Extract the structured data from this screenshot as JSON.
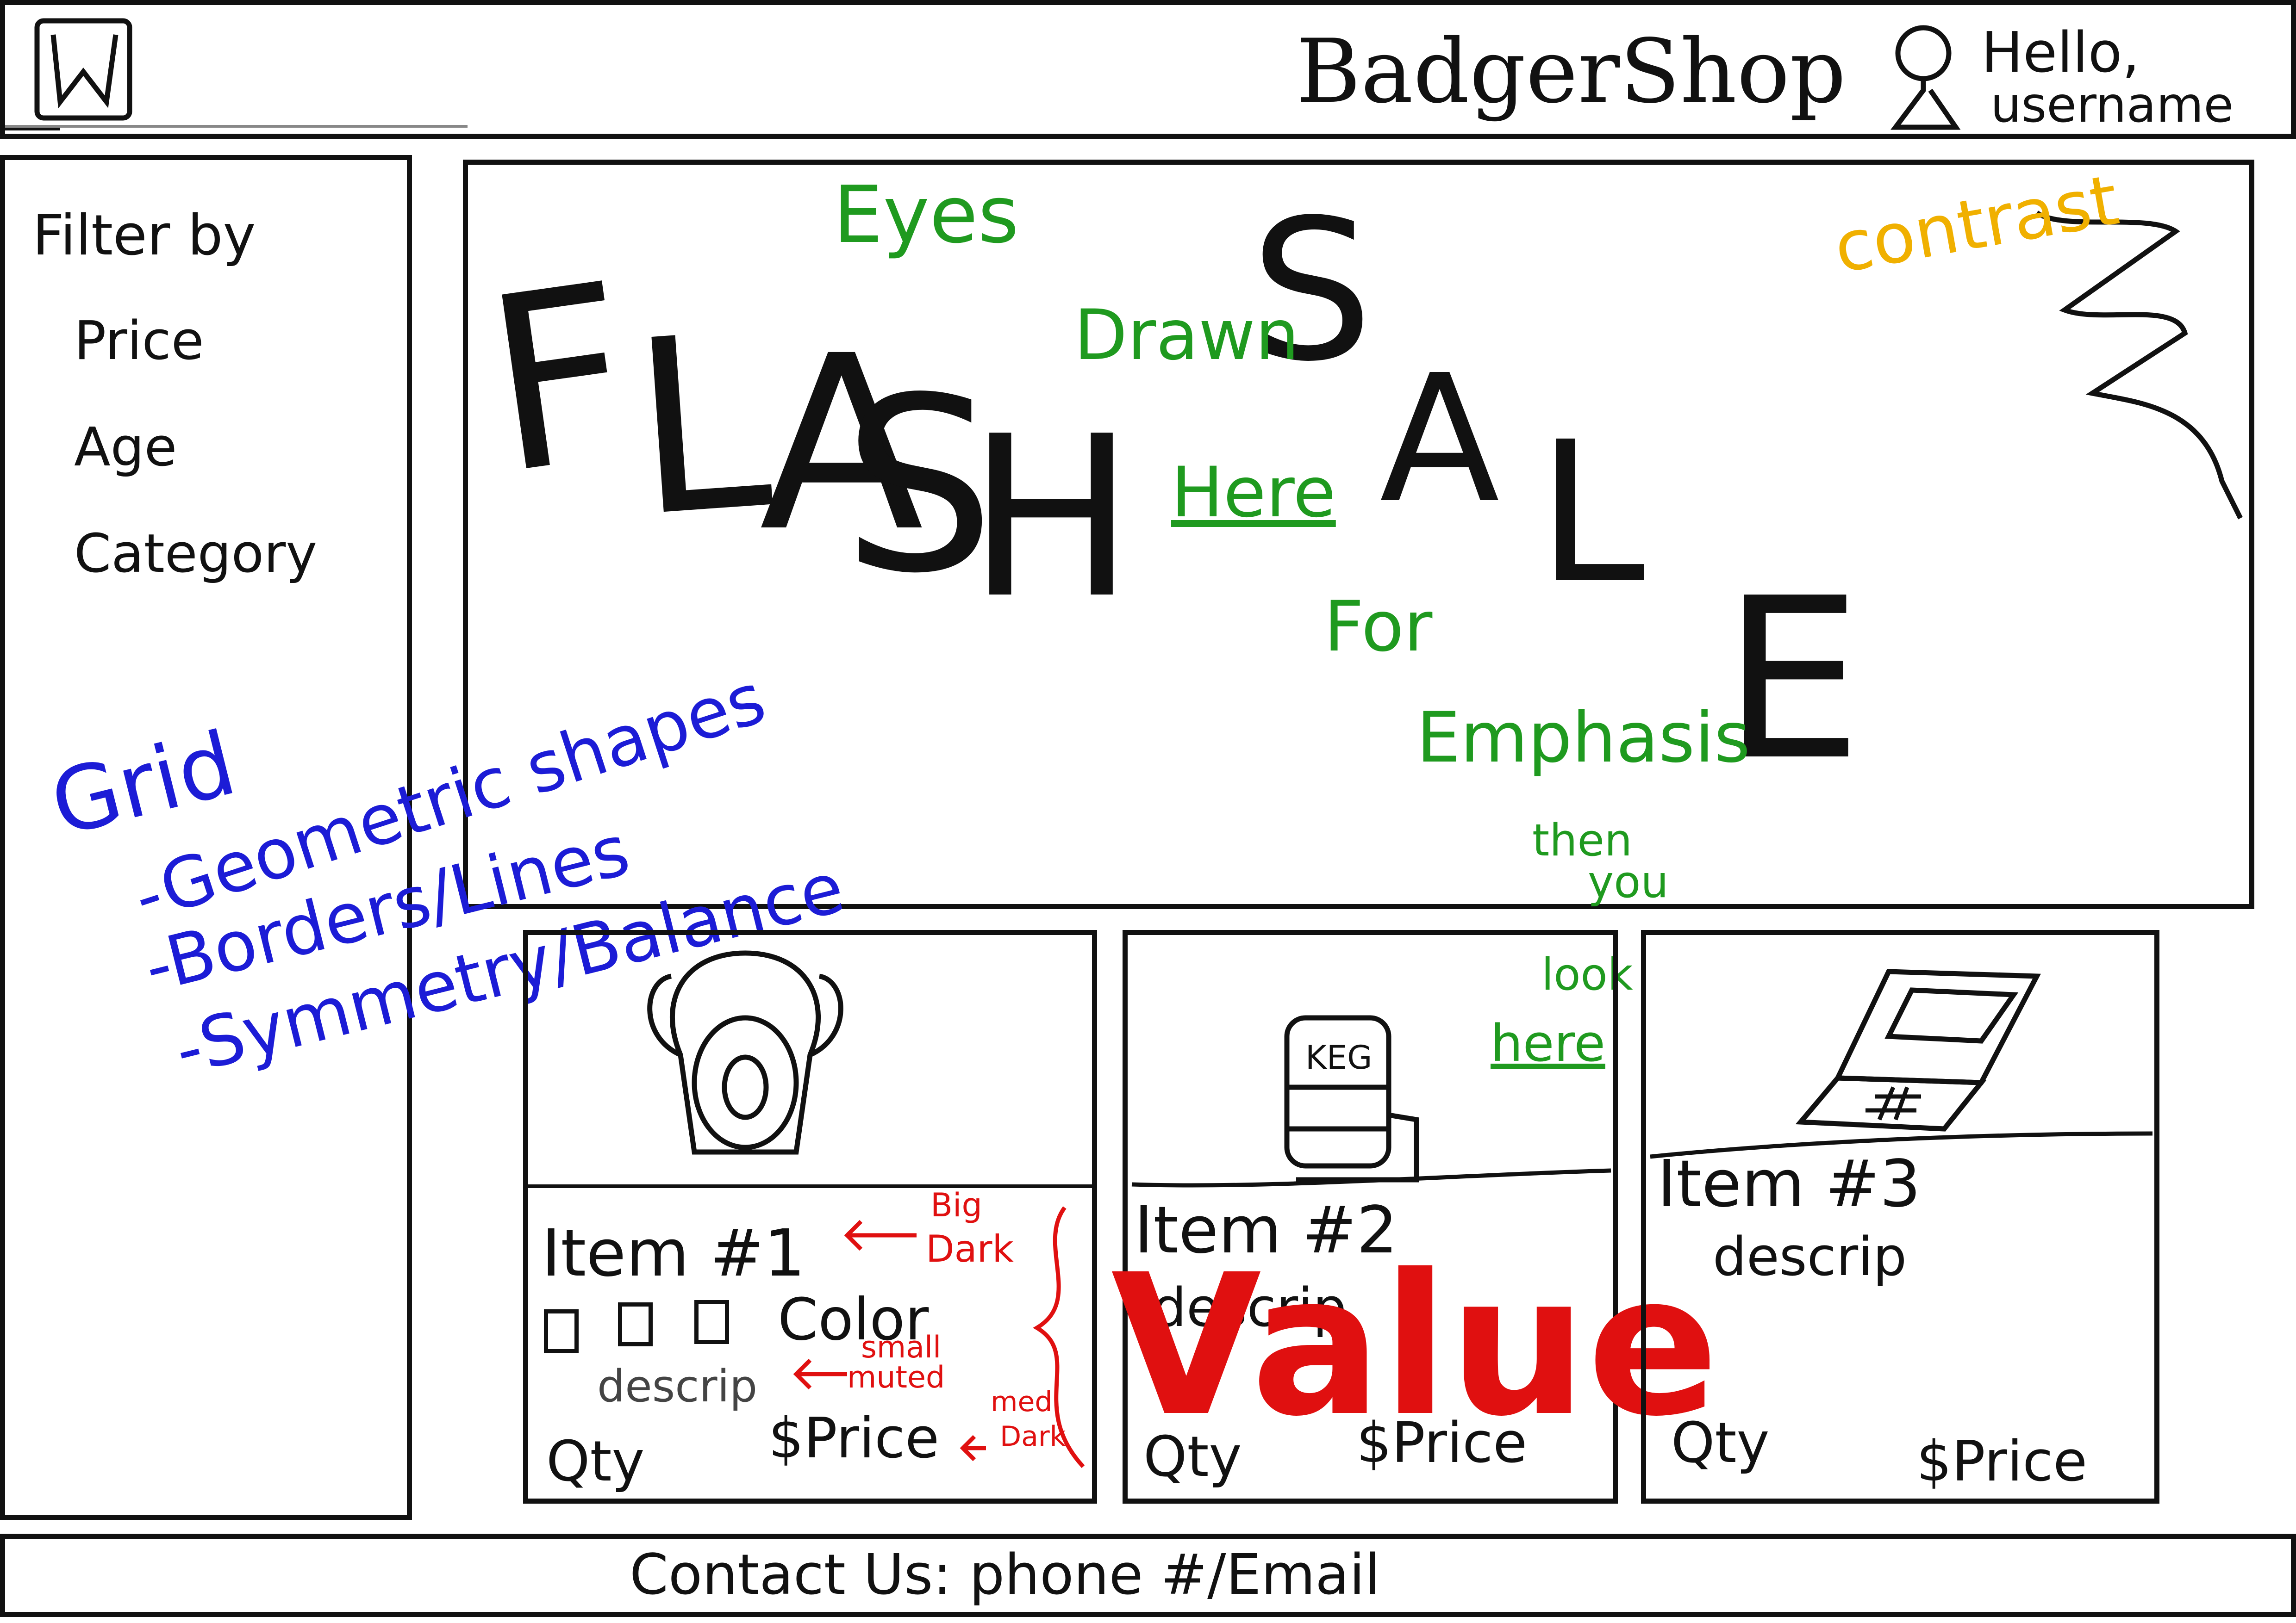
{
  "header": {
    "brand": "BadgerShop",
    "greeting": "Hello,",
    "username": "username",
    "logo_icon": "university-w-logo",
    "user_icon": "user-avatar-icon"
  },
  "sidebar": {
    "title": "Filter by",
    "options": [
      "Price",
      "Age",
      "Category"
    ]
  },
  "banner": {
    "headline_letters": [
      "F",
      "L",
      "A",
      "S",
      "H",
      "S",
      "A",
      "L",
      "E"
    ]
  },
  "annotations": {
    "eyes": "Eyes",
    "drawn": "Drawn",
    "here": "Here",
    "for": "For",
    "emphasis": "Emphasis",
    "then": "then",
    "you": "you",
    "look": "look",
    "here2": "here",
    "contrast": "contrast",
    "grid": "Grid",
    "geometric": "-Geometric shapes",
    "borders": "-Borders/Lines",
    "symmetry": "-Symmetry/Balance",
    "big": "Big",
    "dark": "Dark",
    "small": "small",
    "muted": "muted",
    "med": "med",
    "dark2": "Dark",
    "value": "Value",
    "colors": {
      "green": "#1f9a1f",
      "blue": "#1c1cd6",
      "red": "#e01010",
      "orange": "#f0b000"
    }
  },
  "products": [
    {
      "title": "Item #1",
      "color_label": "Color",
      "desc": "descrip",
      "qty": "Qty",
      "price": "$Price",
      "icon": "backpack-icon"
    },
    {
      "title": "Item #2",
      "desc": "descrip",
      "qty": "Qty",
      "price": "$Price",
      "icon": "keg-icon",
      "keg_label": "KEG"
    },
    {
      "title": "Item #3",
      "desc": "descrip",
      "qty": "Qty",
      "price": "$Price",
      "icon": "laptop-icon"
    }
  ],
  "footer": {
    "contact": "Contact Us: phone #/Email"
  }
}
